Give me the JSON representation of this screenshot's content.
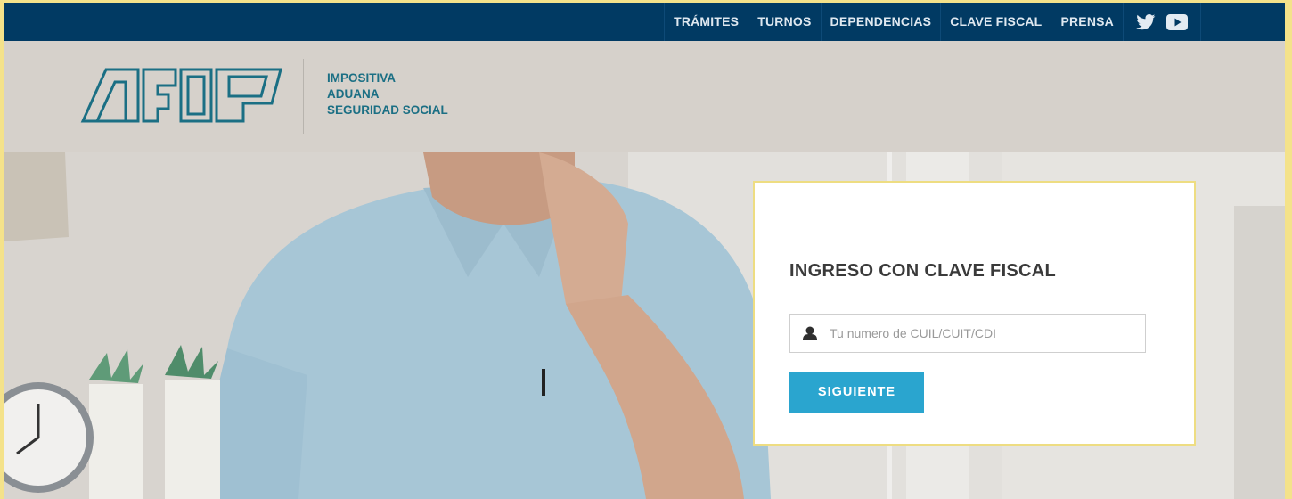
{
  "topnav": {
    "items": [
      {
        "label": "TRÁMITES"
      },
      {
        "label": "TURNOS"
      },
      {
        "label": "DEPENDENCIAS"
      },
      {
        "label": "CLAVE FISCAL"
      },
      {
        "label": "PRENSA"
      }
    ],
    "social": [
      {
        "icon": "twitter-icon"
      },
      {
        "icon": "youtube-icon"
      }
    ]
  },
  "header": {
    "logo_alt": "AFIP",
    "tagline": [
      "IMPOSITIVA",
      "ADUANA",
      "SEGURIDAD SOCIAL"
    ]
  },
  "login": {
    "title": "INGRESO CON CLAVE FISCAL",
    "input_placeholder": "Tu numero de CUIL/CUIT/CDI",
    "input_value": "",
    "submit_label": "SIGUIENTE",
    "input_icon": "user-icon"
  },
  "colors": {
    "topbar": "#013a63",
    "brand_teal": "#1b6f84",
    "button": "#2aa5cf",
    "card_border": "#eedd82"
  }
}
